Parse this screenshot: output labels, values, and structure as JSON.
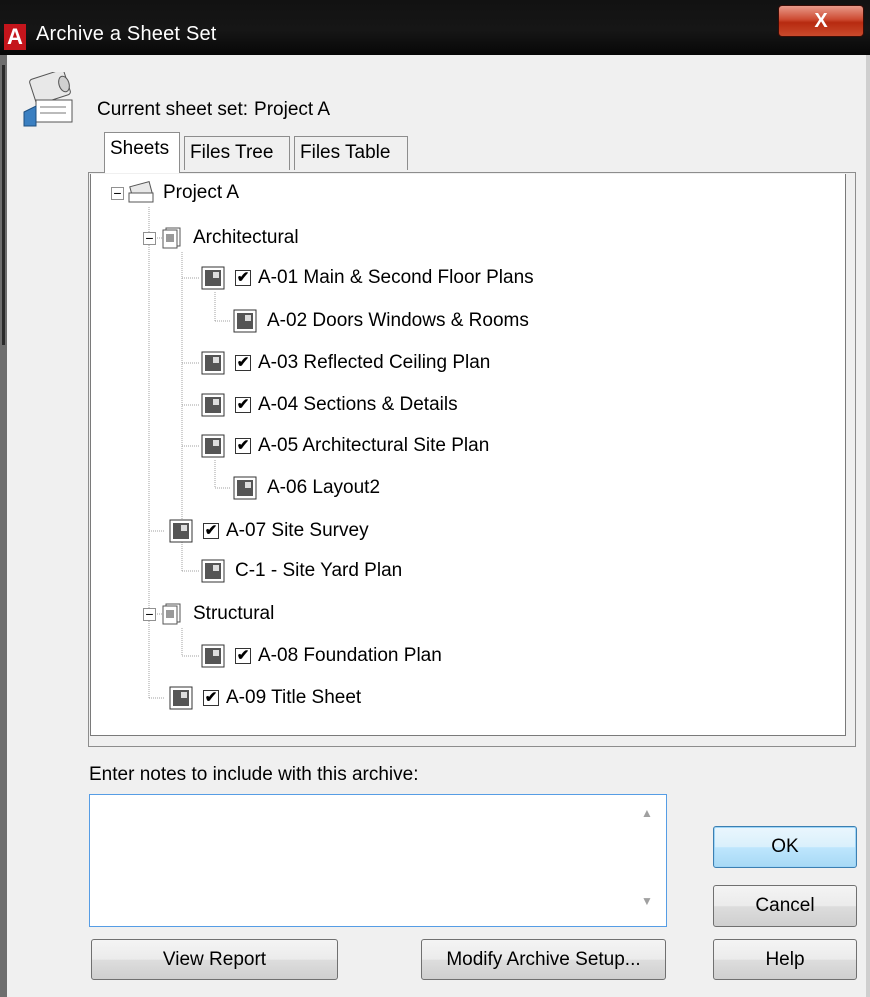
{
  "window": {
    "title": "Archive a Sheet Set",
    "close_label": "X"
  },
  "header": {
    "current_label": "Current sheet set:",
    "current_value": "Project A"
  },
  "tabs": [
    {
      "label": "Sheets",
      "active": true
    },
    {
      "label": "Files Tree",
      "active": false
    },
    {
      "label": "Files Table",
      "active": false
    }
  ],
  "tree": {
    "root": "Project A",
    "groups": {
      "architectural": "Architectural",
      "structural": "Structural"
    },
    "sheets": [
      {
        "label": "A-01 Main & Second Floor Plans",
        "checked": true
      },
      {
        "label": "A-02 Doors Windows & Rooms",
        "checked": false
      },
      {
        "label": "A-03 Reflected Ceiling Plan",
        "checked": true
      },
      {
        "label": "A-04 Sections & Details",
        "checked": true
      },
      {
        "label": "A-05 Architectural Site Plan",
        "checked": true
      },
      {
        "label": "A-06 Layout2",
        "checked": false
      },
      {
        "label": "A-07 Site Survey",
        "checked": true
      },
      {
        "label": "C-1 - Site Yard Plan",
        "checked": false
      },
      {
        "label": "A-08 Foundation Plan",
        "checked": true
      },
      {
        "label": "A-09 Title Sheet",
        "checked": true
      }
    ]
  },
  "notes": {
    "label": "Enter notes to include with this archive:",
    "value": ""
  },
  "buttons": {
    "view_report": "View Report",
    "modify_setup": "Modify Archive Setup...",
    "ok": "OK",
    "cancel": "Cancel",
    "help": "Help"
  }
}
